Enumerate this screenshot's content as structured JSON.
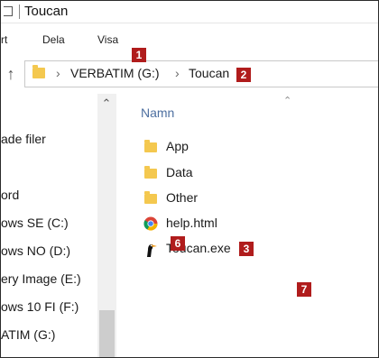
{
  "window": {
    "title": "Toucan"
  },
  "ribbon": {
    "tabs": [
      "rt",
      "Dela",
      "Visa"
    ]
  },
  "address": {
    "drive": "VERBATIM (G:)",
    "folder": "Toucan"
  },
  "callouts": {
    "c1": "1",
    "c2": "2",
    "c3": "3",
    "c6": "6",
    "c7": "7"
  },
  "nav": {
    "items": [
      "ade filer",
      "ord",
      "ows SE (C:)",
      "ows NO (D:)",
      "ery Image (E:)",
      "ows 10 FI (F:)",
      "ATIM (G:)"
    ]
  },
  "content": {
    "column_header": "Namn",
    "files": [
      {
        "name": "App",
        "type": "folder"
      },
      {
        "name": "Data",
        "type": "folder"
      },
      {
        "name": "Other",
        "type": "folder"
      },
      {
        "name": "help.html",
        "type": "chrome-html"
      },
      {
        "name": "Toucan.exe",
        "type": "toucan-exe"
      }
    ]
  },
  "icons": {
    "title": "folder-window-icon",
    "up": "up-arrow-icon",
    "address_folder": "folder-icon",
    "chevron": "chevron-right-icon",
    "sort": "sort-up-icon",
    "scroll_up": "scroll-up-icon"
  },
  "colors": {
    "callout": "#b01c1c",
    "folder": "#f4c84f",
    "header_text": "#4d6fa0"
  }
}
